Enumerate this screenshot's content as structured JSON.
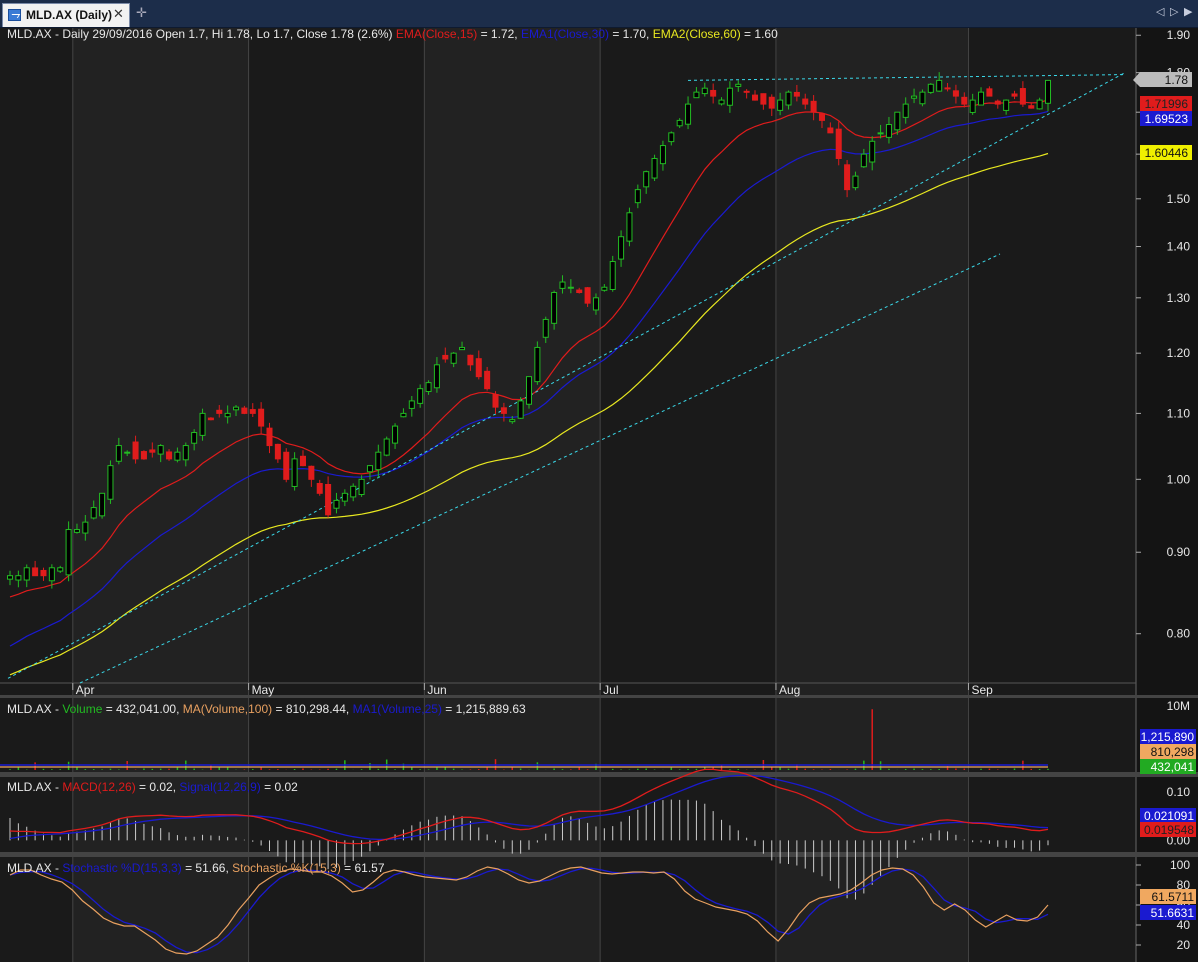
{
  "tab": {
    "label": "MLD.AX (Daily)",
    "close": "✕",
    "new": "✛"
  },
  "nav": {
    "prev": "◁",
    "down": "▷",
    "next": "▶"
  },
  "colors": {
    "up": "#22bb22",
    "down": "#e01c1c",
    "ema15": "#e01c1c",
    "ema1": "#1a1ad0",
    "ema2": "#e8e820",
    "trend": "#3ad8e8",
    "grid": "#383838",
    "bg": "#1a1a1a",
    "alt": "#222222",
    "text": "#e8e8e8"
  },
  "chart_data": [
    {
      "type": "candlestick",
      "header": "MLD.AX - Daily 29/09/2016 Open 1.7, Hi 1.78, Lo 1.7, Close 1.78 (2.6%)",
      "legend": [
        {
          "name": "EMA(Close,15)",
          "value": "= 1.72,",
          "color": "#e01c1c"
        },
        {
          "name": "EMA1(Close,30)",
          "value": "= 1.70,",
          "color": "#1a1ad0"
        },
        {
          "name": "EMA2(Close,60)",
          "value": "= 1.60",
          "color": "#e8e820"
        }
      ],
      "y_ticks": [
        "1.90",
        "1.80",
        "1.70",
        "1.60",
        "1.50",
        "1.40",
        "1.30",
        "1.20",
        "1.10",
        "1.00",
        "0.90",
        "0.80"
      ],
      "y_tick_values": [
        1.9,
        1.8,
        1.7,
        1.6,
        1.5,
        1.4,
        1.3,
        1.2,
        1.1,
        1.0,
        0.9,
        0.8
      ],
      "ylim": [
        0.745,
        1.92
      ],
      "log_scale": true,
      "months": [
        "Apr",
        "May",
        "Jun",
        "Jul",
        "Aug",
        "Sep"
      ],
      "month_start_index": [
        8,
        29,
        50,
        71,
        92,
        115
      ],
      "price_tags": [
        {
          "text": "1.78",
          "value": 1.78,
          "color": "#bbbbbb",
          "fg": "#111"
        },
        {
          "text": "1.71996",
          "value": 1.72,
          "color": "#e01c1c",
          "fg": "#222"
        },
        {
          "text": "1.69523",
          "value": 1.695,
          "color": "#1a1ad0",
          "fg": "#ffffff"
        },
        {
          "text": "1.60446",
          "value": 1.604,
          "color": "#f0f000",
          "fg": "#111"
        }
      ],
      "closes": [
        0.87,
        0.87,
        0.88,
        0.87,
        0.87,
        0.88,
        0.88,
        0.93,
        0.93,
        0.94,
        0.96,
        0.98,
        1.02,
        1.05,
        1.04,
        1.03,
        1.03,
        1.04,
        1.05,
        1.03,
        1.04,
        1.05,
        1.07,
        1.1,
        1.09,
        1.1,
        1.1,
        1.11,
        1.1,
        1.1,
        1.08,
        1.05,
        1.03,
        1.0,
        1.03,
        1.02,
        1.0,
        0.98,
        0.95,
        0.97,
        0.98,
        0.99,
        1.0,
        1.02,
        1.04,
        1.06,
        1.08,
        1.1,
        1.12,
        1.14,
        1.15,
        1.18,
        1.19,
        1.2,
        1.21,
        1.18,
        1.16,
        1.14,
        1.11,
        1.1,
        1.09,
        1.12,
        1.16,
        1.21,
        1.26,
        1.31,
        1.33,
        1.32,
        1.31,
        1.29,
        1.3,
        1.32,
        1.37,
        1.42,
        1.47,
        1.52,
        1.56,
        1.59,
        1.62,
        1.65,
        1.68,
        1.72,
        1.75,
        1.76,
        1.74,
        1.73,
        1.76,
        1.77,
        1.75,
        1.73,
        1.72,
        1.71,
        1.73,
        1.75,
        1.74,
        1.72,
        1.7,
        1.68,
        1.65,
        1.59,
        1.52,
        1.55,
        1.6,
        1.63,
        1.65,
        1.67,
        1.7,
        1.72,
        1.74,
        1.75,
        1.77,
        1.78,
        1.76,
        1.74,
        1.72,
        1.73,
        1.75,
        1.74,
        1.72,
        1.73,
        1.74,
        1.72,
        1.71,
        1.73,
        1.78
      ],
      "ema15_end": 1.72,
      "ema1_end": 1.695,
      "ema2_end": 1.6
    },
    {
      "type": "bar",
      "header": "MLD.AX - Volume = 432,041.00,",
      "legend": [
        {
          "name": "MA(Volume,100)",
          "value": "= 810,298.44,",
          "color": "#e8a060"
        },
        {
          "name": "MA1(Volume,25)",
          "value": "= 1,215,889.63",
          "color": "#1a1ad0"
        }
      ],
      "y_ticks": [
        "10M"
      ],
      "ylim": [
        0,
        10000000
      ],
      "tags": [
        {
          "text": "1,215,890",
          "color": "#1a1ad0",
          "fg": "#ffffff"
        },
        {
          "text": "810,298",
          "color": "#f0a860",
          "fg": "#111"
        },
        {
          "text": "432,041",
          "color": "#22aa22",
          "fg": "#ffffff"
        }
      ],
      "spike": {
        "index": 103,
        "value": 9800000
      }
    },
    {
      "type": "line",
      "header": "MLD.AX -",
      "legend": [
        {
          "name": "MACD(12,26)",
          "value": "= 0.02,",
          "color": "#e01c1c"
        },
        {
          "name": "Signal(12,26,9)",
          "value": "= 0.02",
          "color": "#1a1ad0"
        }
      ],
      "y_ticks": [
        "0.10",
        "0.05",
        "0.00"
      ],
      "y_tick_values": [
        0.1,
        0.05,
        0.0
      ],
      "ylim": [
        -0.02,
        0.125
      ],
      "tags": [
        {
          "text": "0.021091",
          "color": "#1a1ad0",
          "fg": "#ffffff"
        },
        {
          "text": "0.019548",
          "color": "#e01c1c",
          "fg": "#222"
        }
      ]
    },
    {
      "type": "line",
      "header": "MLD.AX -",
      "legend": [
        {
          "name": "Stochastic %D(15,3,3)",
          "value": "= 51.66,",
          "color": "#1a1ad0"
        },
        {
          "name": "Stochastic %K(15,3)",
          "value": "= 61.57",
          "color": "#e8a060"
        }
      ],
      "y_ticks": [
        "100",
        "80",
        "60",
        "40",
        "20"
      ],
      "y_tick_values": [
        100,
        80,
        60,
        40,
        20
      ],
      "ylim": [
        5,
        105
      ],
      "tags": [
        {
          "text": "61.5711",
          "color": "#f0a860",
          "fg": "#111"
        },
        {
          "text": "51.6631",
          "color": "#1a1ad0",
          "fg": "#ffffff"
        }
      ],
      "k": [
        90,
        95,
        95,
        90,
        86,
        83,
        75,
        64,
        56,
        47,
        42,
        39,
        39,
        32,
        25,
        16,
        12,
        11,
        14,
        21,
        28,
        40,
        55,
        67,
        80,
        87,
        93,
        96,
        95,
        93,
        93,
        89,
        82,
        73,
        75,
        83,
        92,
        95,
        93,
        90,
        88,
        87,
        86,
        85,
        88,
        94,
        98,
        96,
        91,
        85,
        82,
        84,
        89,
        94,
        97,
        98,
        95,
        92,
        91,
        92,
        93,
        93,
        92,
        93,
        86,
        74,
        66,
        62,
        58,
        56,
        54,
        51,
        44,
        33,
        24,
        36,
        51,
        62,
        67,
        69,
        71,
        75,
        82,
        90,
        95,
        97,
        96,
        90,
        78,
        62,
        55,
        61,
        55,
        45,
        38,
        44,
        50,
        45,
        44,
        48,
        60
      ]
    }
  ]
}
